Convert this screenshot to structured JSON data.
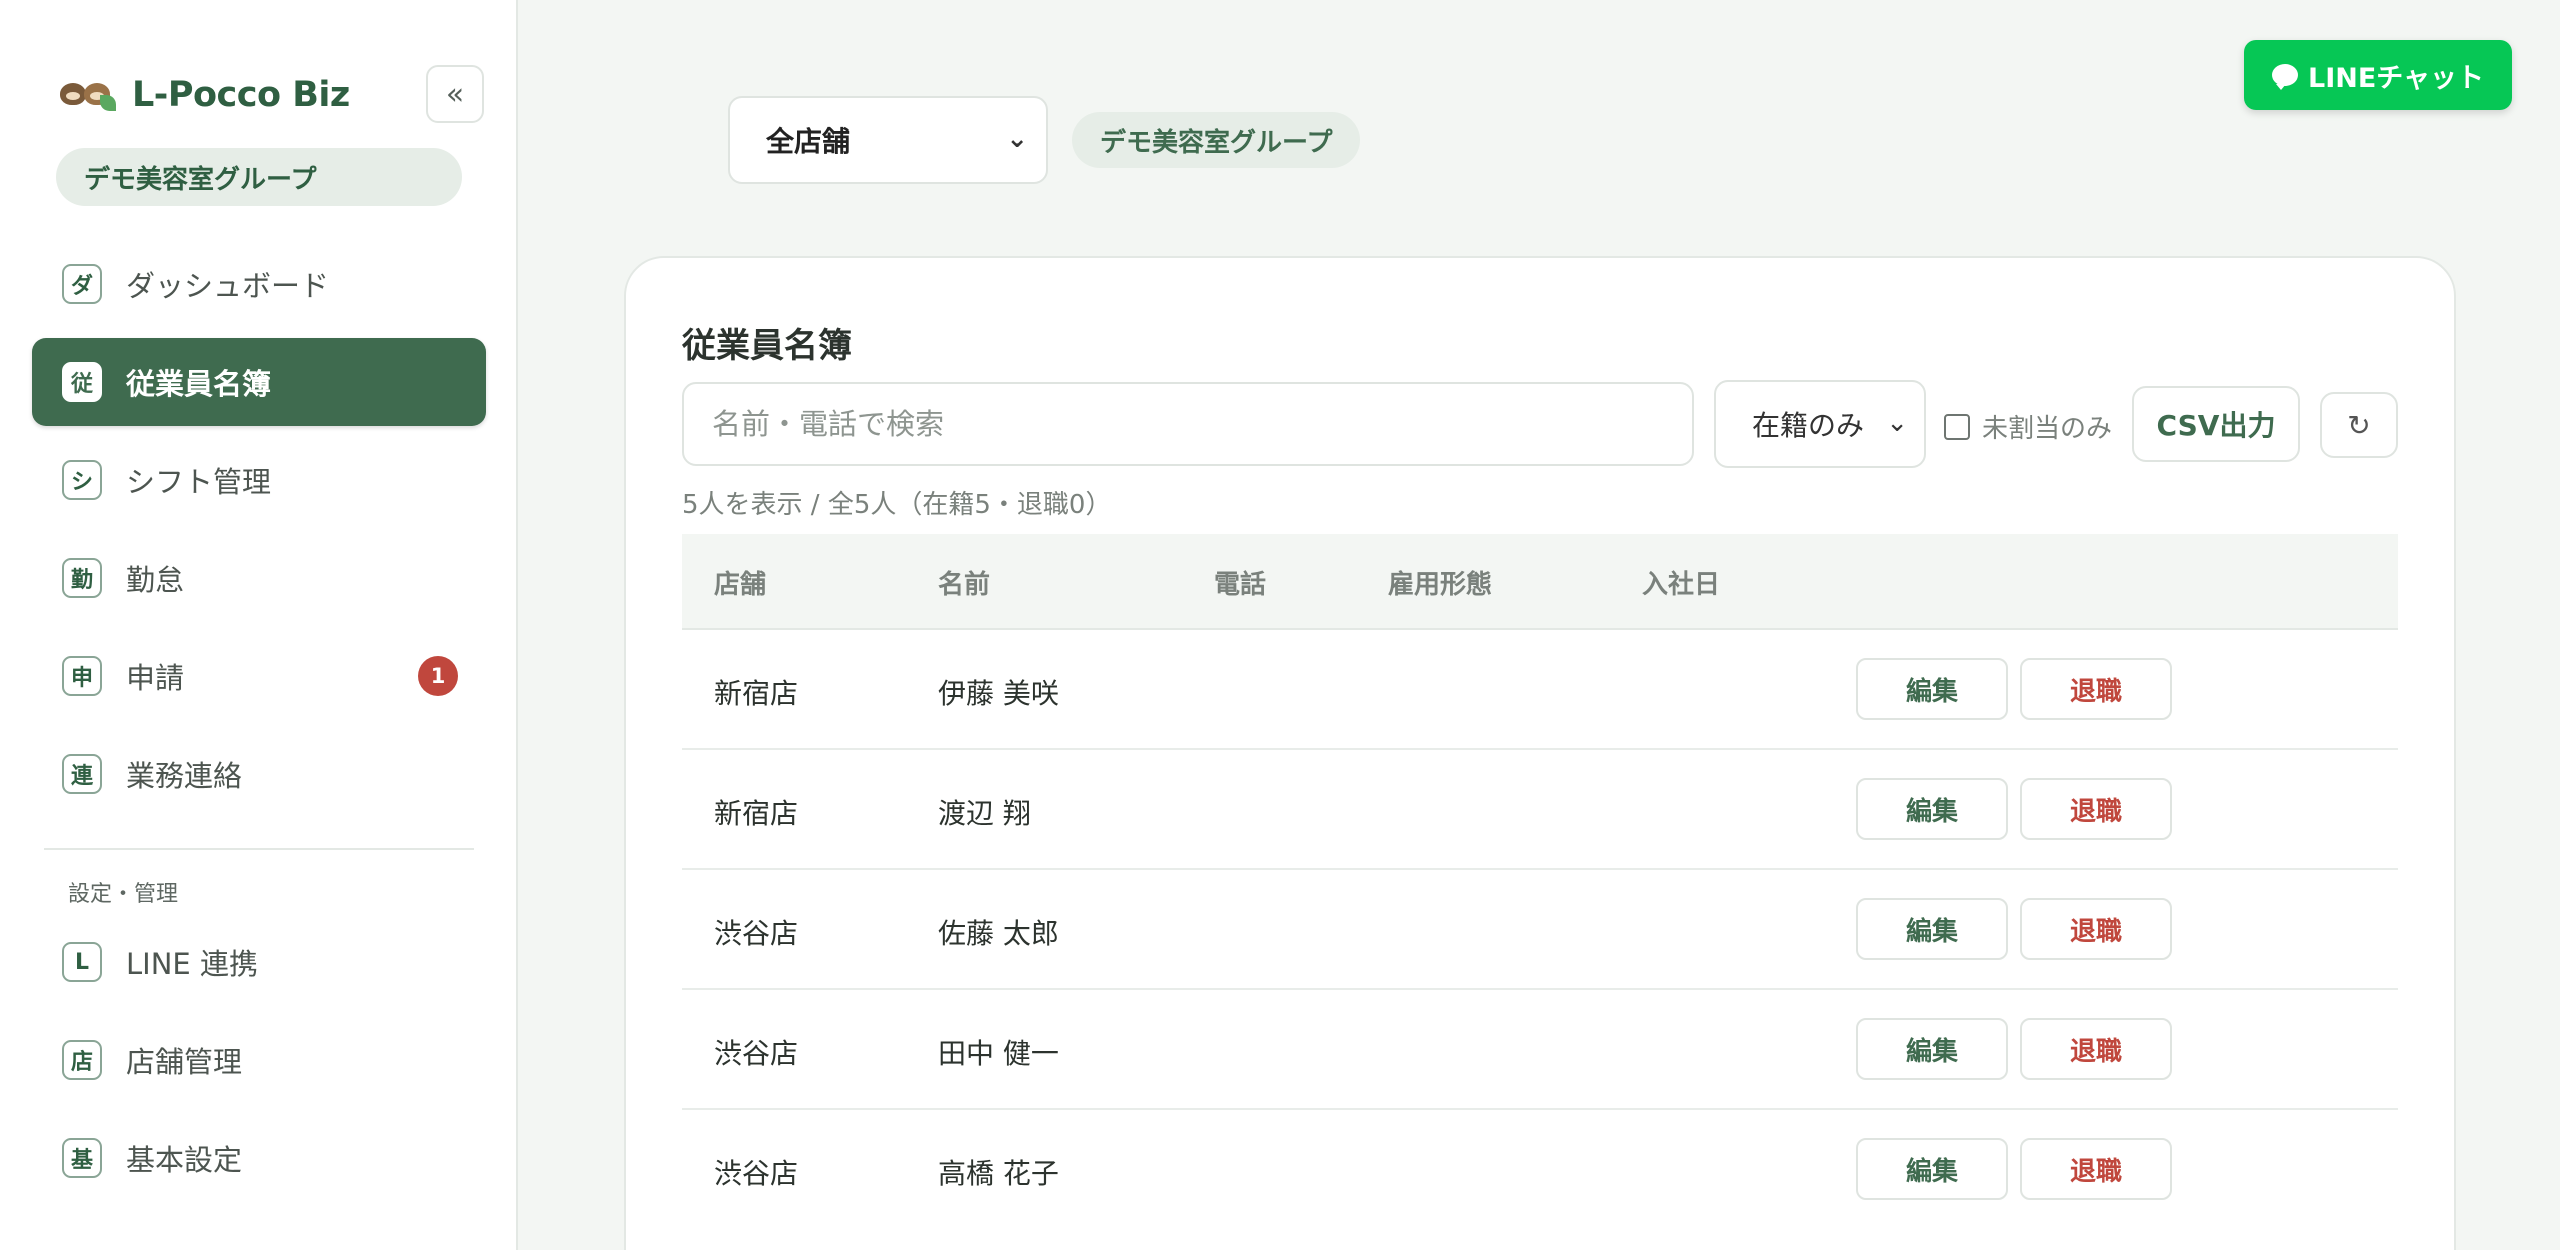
{
  "sidebar": {
    "brand": "L-Pocco Biz",
    "collapse_icon": "«",
    "org": "デモ美容室グループ",
    "items": [
      {
        "icon": "ダ",
        "label": "ダッシュボード"
      },
      {
        "icon": "従",
        "label": "従業員名簿",
        "active": true
      },
      {
        "icon": "シ",
        "label": "シフト管理"
      },
      {
        "icon": "勤",
        "label": "勤怠"
      },
      {
        "icon": "申",
        "label": "申請",
        "badge": "1"
      },
      {
        "icon": "連",
        "label": "業務連絡"
      }
    ],
    "section_label": "設定・管理",
    "settings_items": [
      {
        "icon": "L",
        "label": "LINE 連携"
      },
      {
        "icon": "店",
        "label": "店舗管理"
      },
      {
        "icon": "基",
        "label": "基本設定"
      }
    ]
  },
  "topbar": {
    "store_select": "全店舗",
    "org_tag": "デモ美容室グループ",
    "line_button": "LINEチャット"
  },
  "main": {
    "title": "従業員名簿",
    "search_placeholder": "名前・電話で検索",
    "status_filter": "在籍のみ",
    "unassigned_label": "未割当のみ",
    "csv_button": "CSV出力",
    "refresh_icon": "↻",
    "count_text": "5人を表示 / 全5人（在籍5・退職0）",
    "columns": [
      "店舗",
      "名前",
      "電話",
      "雇用形態",
      "入社日"
    ],
    "rows": [
      {
        "store": "新宿店",
        "name": "伊藤 美咲",
        "phone": "",
        "type": "",
        "date": ""
      },
      {
        "store": "新宿店",
        "name": "渡辺 翔",
        "phone": "",
        "type": "",
        "date": ""
      },
      {
        "store": "渋谷店",
        "name": "佐藤 太郎",
        "phone": "",
        "type": "",
        "date": ""
      },
      {
        "store": "渋谷店",
        "name": "田中 健一",
        "phone": "",
        "type": "",
        "date": ""
      },
      {
        "store": "渋谷店",
        "name": "高橋 花子",
        "phone": "",
        "type": "",
        "date": ""
      }
    ],
    "edit_label": "編集",
    "retire_label": "退職"
  },
  "colors": {
    "accent": "#3f6b4f",
    "line_green": "#06c755",
    "danger": "#c0473d"
  }
}
